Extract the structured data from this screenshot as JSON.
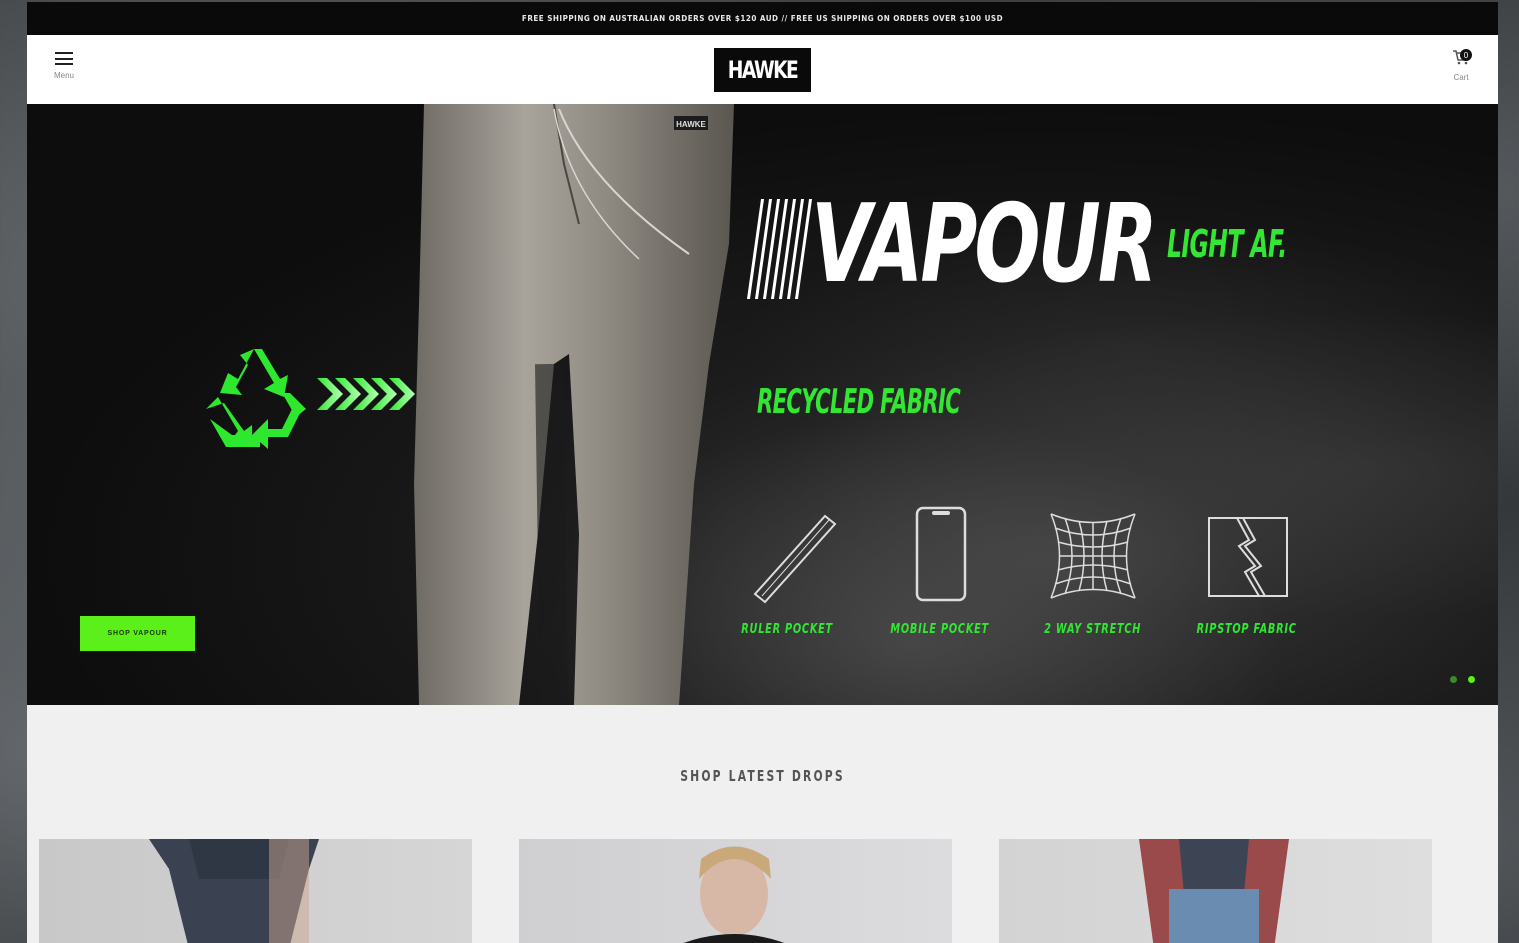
{
  "announcement": "FREE SHIPPING ON AUSTRALIAN ORDERS OVER $120 AUD // FREE US SHIPPING ON ORDERS OVER $100 USD",
  "header": {
    "menu_label": "Menu",
    "logo_text": "HAWKE",
    "cart_label": "Cart",
    "cart_count": "0"
  },
  "hero": {
    "title": "VAPOUR",
    "tagline": "LIGHT AF.",
    "subtitle": "RECYCLED FABRIC",
    "pants_tag": "HAWKE",
    "features": [
      {
        "label": "RULER POCKET",
        "icon": "ruler-icon"
      },
      {
        "label": "MOBILE POCKET",
        "icon": "phone-icon"
      },
      {
        "label": "2 WAY STRETCH",
        "icon": "stretch-grid-icon"
      },
      {
        "label": "RIPSTOP FABRIC",
        "icon": "ripstop-icon"
      }
    ],
    "cta_label": "SHOP VAPOUR",
    "slides": [
      {
        "active": false
      },
      {
        "active": true
      }
    ]
  },
  "colors": {
    "accent_green": "#33e633",
    "button_green": "#5cf01a",
    "dark": "#0a0a0a"
  },
  "section": {
    "title": "SHOP LATEST DROPS"
  }
}
